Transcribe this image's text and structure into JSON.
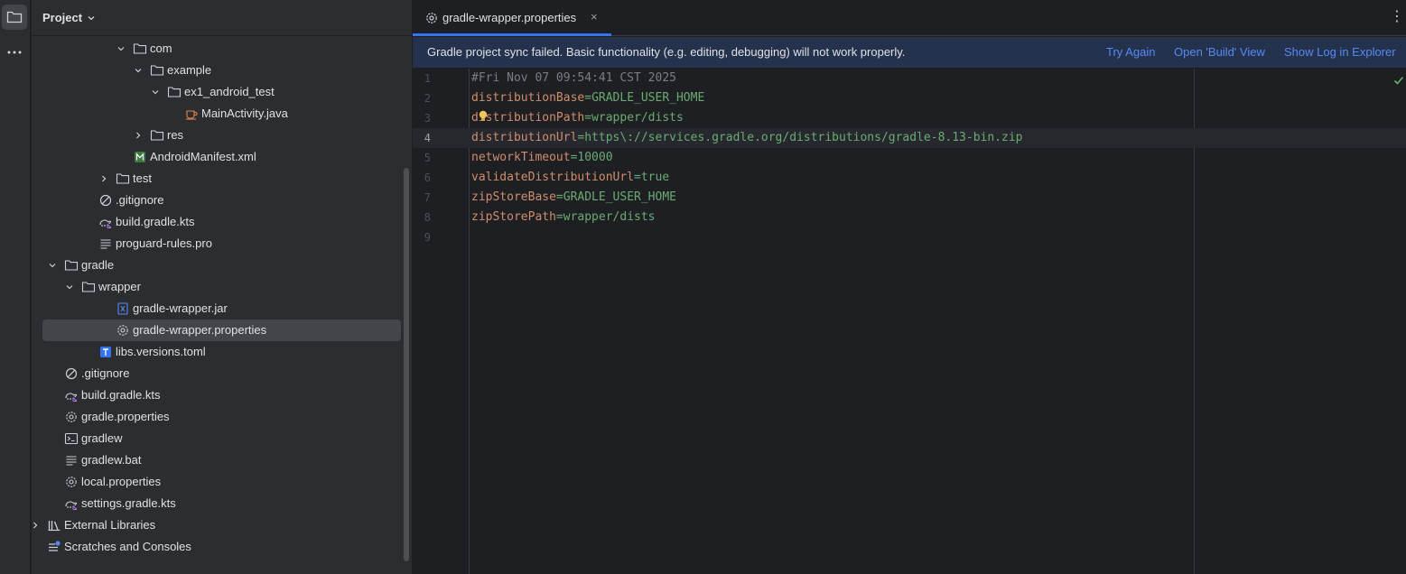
{
  "project_panel": {
    "title": "Project",
    "tree": [
      {
        "label": "com",
        "type": "folder",
        "expanded": true
      },
      {
        "label": "example",
        "type": "folder",
        "expanded": true
      },
      {
        "label": "ex1_android_test",
        "type": "folder",
        "expanded": true
      },
      {
        "label": "MainActivity.java",
        "type": "java"
      },
      {
        "label": "res",
        "type": "folder",
        "expanded": false
      },
      {
        "label": "AndroidManifest.xml",
        "type": "manifest"
      },
      {
        "label": "test",
        "type": "folder",
        "expanded": false
      },
      {
        "label": ".gitignore",
        "type": "gitignore"
      },
      {
        "label": "build.gradle.kts",
        "type": "gradle-kts"
      },
      {
        "label": "proguard-rules.pro",
        "type": "text"
      },
      {
        "label": "gradle",
        "type": "folder",
        "expanded": true
      },
      {
        "label": "wrapper",
        "type": "folder",
        "expanded": true
      },
      {
        "label": "gradle-wrapper.jar",
        "type": "jar"
      },
      {
        "label": "gradle-wrapper.properties",
        "type": "properties",
        "selected": true
      },
      {
        "label": "libs.versions.toml",
        "type": "toml"
      },
      {
        "label": ".gitignore",
        "type": "gitignore"
      },
      {
        "label": "build.gradle.kts",
        "type": "gradle-kts"
      },
      {
        "label": "gradle.properties",
        "type": "properties"
      },
      {
        "label": "gradlew",
        "type": "shell"
      },
      {
        "label": "gradlew.bat",
        "type": "text"
      },
      {
        "label": "local.properties",
        "type": "properties"
      },
      {
        "label": "settings.gradle.kts",
        "type": "gradle-kts"
      },
      {
        "label": "External Libraries",
        "type": "libraries",
        "expanded": false
      },
      {
        "label": "Scratches and Consoles",
        "type": "scratches"
      }
    ]
  },
  "editor": {
    "tab": {
      "label": "gradle-wrapper.properties",
      "close": "×"
    },
    "banner": {
      "message": "Gradle project sync failed. Basic functionality (e.g. editing, debugging) will not work properly.",
      "links": [
        "Try Again",
        "Open 'Build' View",
        "Show Log in Explorer"
      ]
    },
    "current_line": 4,
    "lines": [
      {
        "num": "1",
        "comment": "#Fri Nov 07 09:54:41 CST 2025"
      },
      {
        "num": "2",
        "key": "distributionBase",
        "value": "GRADLE_USER_HOME"
      },
      {
        "num": "3",
        "key": "distributionPath",
        "value": "wrapper/dists"
      },
      {
        "num": "4",
        "key": "distributionUrl",
        "value": "https\\://services.gradle.org/distributions/gradle-8.13-bin.zip"
      },
      {
        "num": "5",
        "key": "networkTimeout",
        "value": "10000"
      },
      {
        "num": "6",
        "key": "validateDistributionUrl",
        "value": "true"
      },
      {
        "num": "7",
        "key": "zipStoreBase",
        "value": "GRADLE_USER_HOME"
      },
      {
        "num": "8",
        "key": "zipStorePath",
        "value": "wrapper/dists"
      },
      {
        "num": "9"
      }
    ]
  },
  "colors": {
    "accent": "#3574f0",
    "link": "#548af7",
    "key": "#cf8e6d",
    "value": "#6aab73",
    "comment": "#7a7e85"
  }
}
